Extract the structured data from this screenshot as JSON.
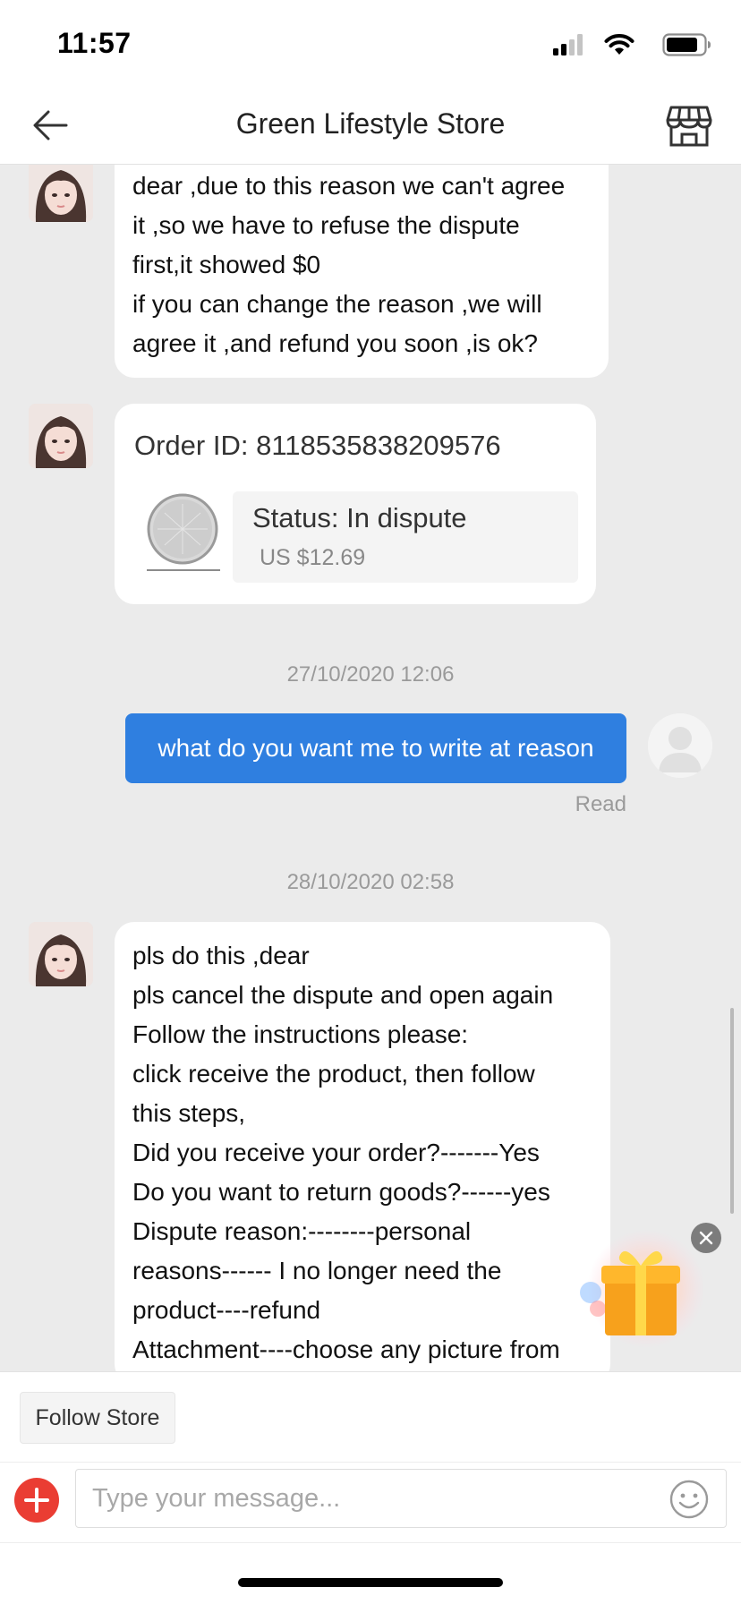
{
  "status_bar": {
    "time": "11:57"
  },
  "header": {
    "title": "Green Lifestyle Store"
  },
  "messages": {
    "msg1": "dear ,due to this reason we can't agree\nit ,so we have to refuse the dispute\nfirst,it showed $0\nif you can change the reason ,we will\nagree it ,and refund you soon ,is ok?",
    "order_card": {
      "order_id": "Order ID: 8118535838209576",
      "status": "Status:  In dispute",
      "price": "US $12.69"
    },
    "timestamp1": "27/10/2020 12:06",
    "outgoing": "what do you want me to write at reason",
    "read_receipt": "Read",
    "timestamp2": "28/10/2020 02:58",
    "msg3": "pls do this ,dear\npls cancel the dispute and open again\nFollow the instructions please:\nclick receive the product, then follow\nthis steps,\nDid you receive your order?-------Yes\nDo you want to return goods?------yes\nDispute reason:--------personal\nreasons------ I no longer need the\nproduct----refund\nAttachment----choose any picture from"
  },
  "bottom": {
    "follow_label": "Follow Store",
    "input_placeholder": "Type your message..."
  },
  "colors": {
    "outgoing_bubble": "#2f7fe0",
    "add_button": "#ea3d33",
    "chat_background": "#ebebeb"
  },
  "icons": {
    "back": "arrow-left-icon",
    "store": "store-icon",
    "add": "plus-icon",
    "emoji": "smiley-icon",
    "gift": "gift-icon",
    "close": "close-icon"
  }
}
